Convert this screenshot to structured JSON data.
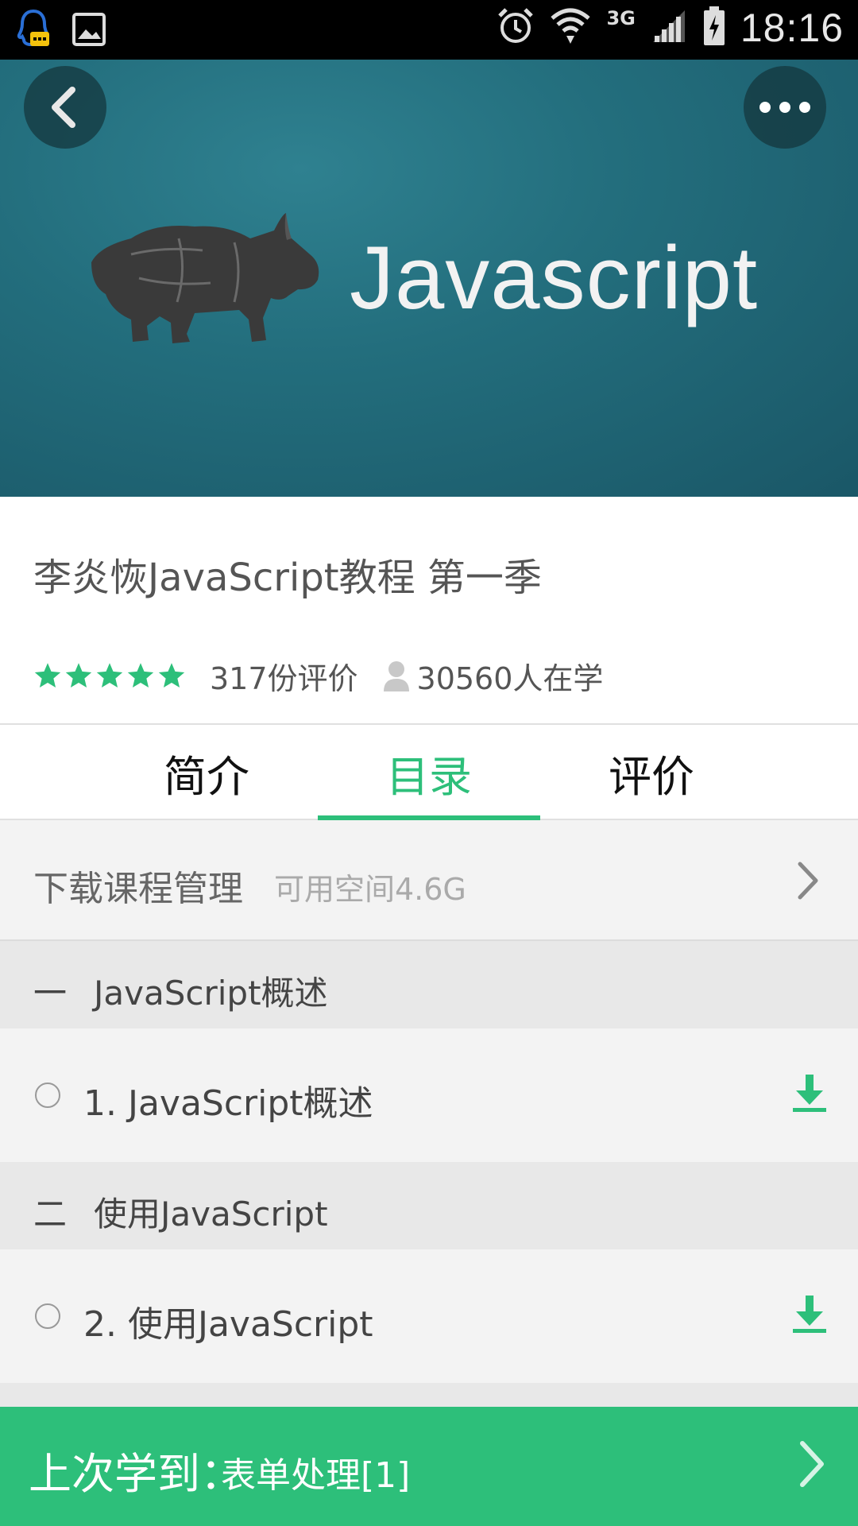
{
  "status_bar": {
    "time": "18:16",
    "network": "3G",
    "left_icons": [
      "qq-notification-icon",
      "image-notification-icon"
    ],
    "right_icons": [
      "alarm-icon",
      "wifi-icon",
      "signal-icon",
      "battery-charging-icon"
    ]
  },
  "banner": {
    "title": "Javascript",
    "image": "rhino-icon"
  },
  "course": {
    "title": "李炎恢JavaScript教程 第一季",
    "rating_stars": 5,
    "rating_max": 5,
    "reviews": "317份评价",
    "learners": "30560人在学"
  },
  "tabs": [
    {
      "label": "简介",
      "active": false
    },
    {
      "label": "目录",
      "active": true
    },
    {
      "label": "评价",
      "active": false
    }
  ],
  "download": {
    "label": "下载课程管理",
    "space": "可用空间4.6G"
  },
  "chapters": [
    {
      "number": "一",
      "title": "JavaScript概述",
      "lessons": [
        {
          "title": "1. JavaScript概述"
        }
      ]
    },
    {
      "number": "二",
      "title": "使用JavaScript",
      "lessons": [
        {
          "title": "2. 使用JavaScript"
        }
      ]
    }
  ],
  "bottom_bar": {
    "prefix": "上次学到：",
    "value": "表单处理[1]"
  },
  "colors": {
    "accent": "#2dbf7a",
    "banner": "#236e7d",
    "status_bar": "#000000"
  }
}
